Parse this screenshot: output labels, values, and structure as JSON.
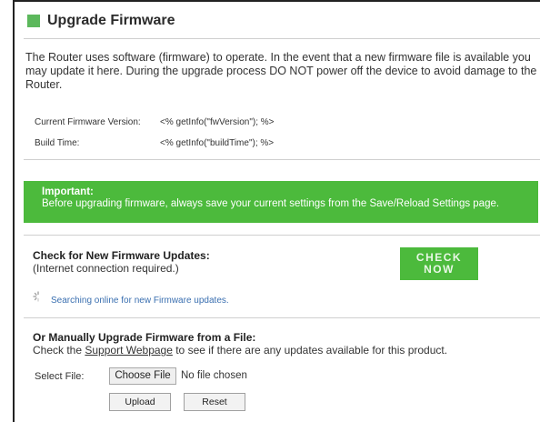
{
  "page": {
    "title": "Upgrade Firmware"
  },
  "intro": "The Router uses software (firmware) to operate. In the event that a new firmware file is available you may update it here. During the upgrade process DO NOT power off the device to avoid damage to the Router.",
  "firmware_info": {
    "version_label": "Current Firmware Version:",
    "version_value": "<% getInfo(\"fwVersion\"); %>",
    "build_label": "Build Time:",
    "build_value": "<% getInfo(\"buildTime\"); %>"
  },
  "important": {
    "title": "Important:",
    "text": "Before upgrading firmware, always save your current settings from the Save/Reload Settings page."
  },
  "check_section": {
    "title": "Check for New Firmware Updates:",
    "subtitle": "(Internet connection required.)",
    "button_line1": "CHECK",
    "button_line2": "NOW",
    "searching_text": "Searching online for new Firmware updates."
  },
  "manual_section": {
    "title": "Or Manually Upgrade Firmware from a File:",
    "text_before": "Check the ",
    "link_text": "Support Webpage",
    "text_after": " to see if there are any updates available for this product.",
    "select_label": "Select File:",
    "choose_button": "Choose File",
    "file_status": "No file chosen",
    "upload_button": "Upload",
    "reset_button": "Reset"
  },
  "colors": {
    "accent_green": "#4cba3c",
    "link_blue": "#3a6fb0"
  }
}
